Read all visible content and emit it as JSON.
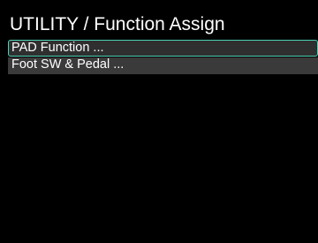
{
  "header": {
    "title": "UTILITY / Function Assign"
  },
  "menu": {
    "items": [
      {
        "label": "PAD Function ...",
        "selected": true
      },
      {
        "label": "Foot SW & Pedal ...",
        "selected": false
      }
    ]
  },
  "colors": {
    "background": "#000000",
    "text": "#ffffff",
    "selection_border": "#4cd2b6",
    "item_background": "#3a3a3a"
  }
}
